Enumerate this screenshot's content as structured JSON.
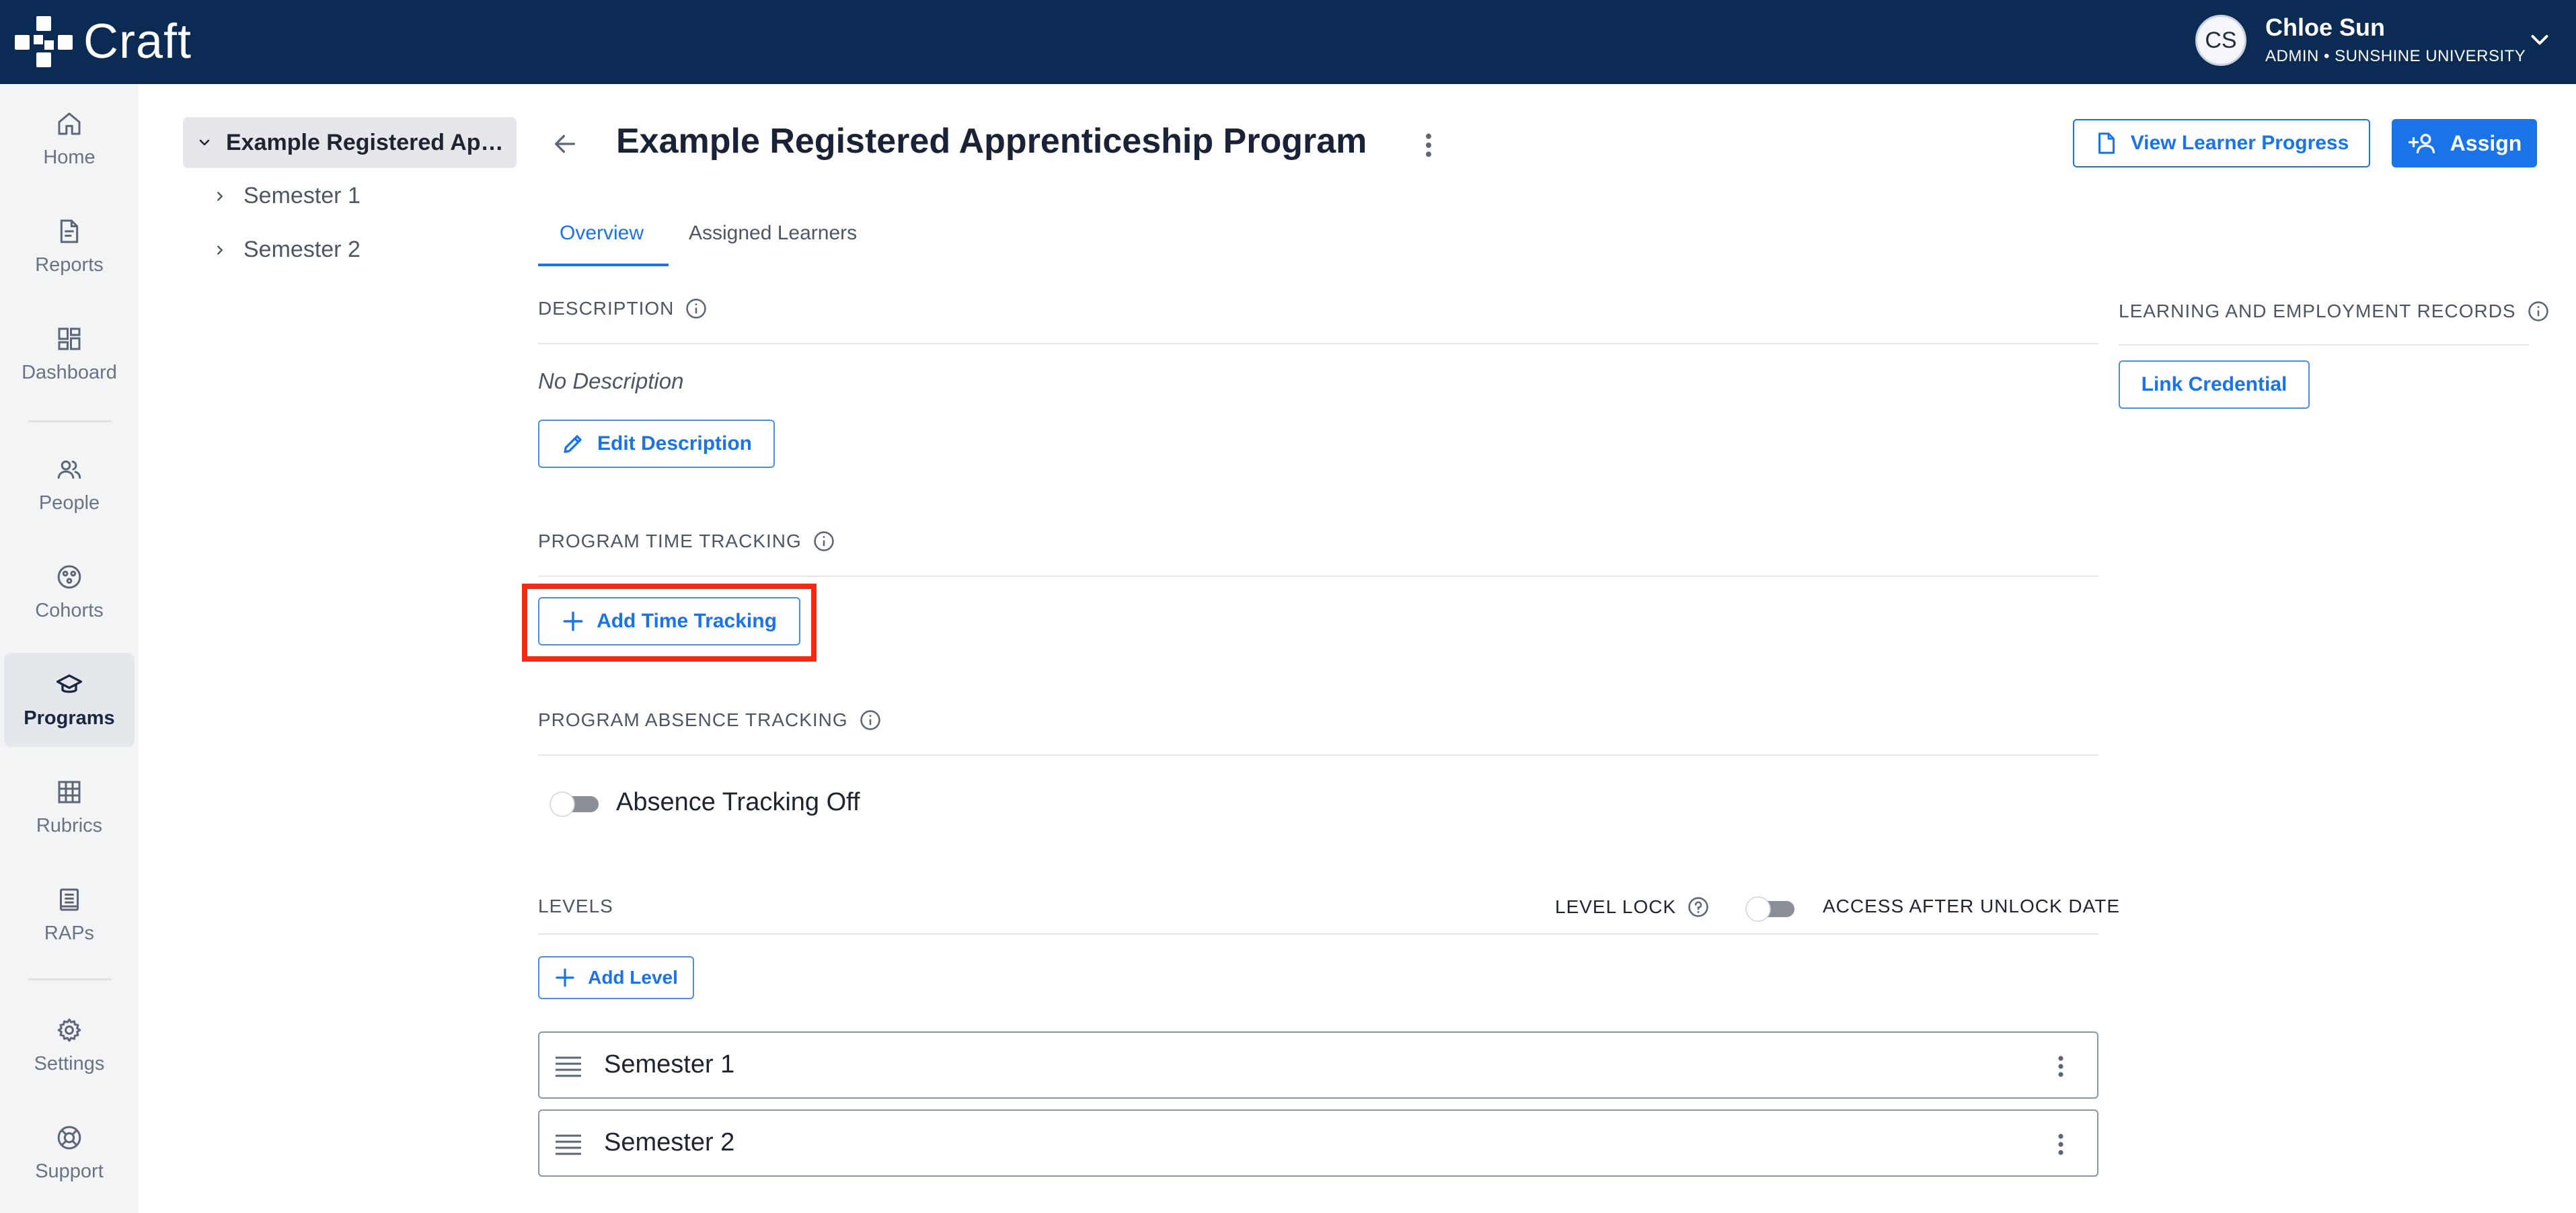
{
  "app": {
    "name": "Craft"
  },
  "user": {
    "initials": "CS",
    "name": "Chloe Sun",
    "role": "ADMIN • SUNSHINE UNIVERSITY"
  },
  "sidebar": {
    "items": [
      {
        "label": "Home",
        "icon": "home-icon"
      },
      {
        "label": "Reports",
        "icon": "document-icon"
      },
      {
        "label": "Dashboard",
        "icon": "dashboard-icon"
      },
      {
        "label": "People",
        "icon": "people-icon"
      },
      {
        "label": "Cohorts",
        "icon": "cohorts-icon"
      },
      {
        "label": "Programs",
        "icon": "graduation-cap-icon",
        "active": true
      },
      {
        "label": "Rubrics",
        "icon": "grid-icon"
      },
      {
        "label": "RAPs",
        "icon": "clipboard-icon"
      },
      {
        "label": "Settings",
        "icon": "gear-icon"
      },
      {
        "label": "Support",
        "icon": "lifebuoy-icon"
      }
    ]
  },
  "tree": {
    "root": "Example Registered Apprenticeship Program",
    "children": [
      "Semester 1",
      "Semester 2"
    ]
  },
  "header": {
    "title": "Example Registered Apprenticeship Program",
    "view_progress_label": "View Learner Progress",
    "assign_label": "Assign"
  },
  "tabs": [
    {
      "label": "Overview",
      "active": true
    },
    {
      "label": "Assigned Learners",
      "active": false
    }
  ],
  "description": {
    "heading": "DESCRIPTION",
    "value": "No Description",
    "edit_label": "Edit Description"
  },
  "time_tracking": {
    "heading": "PROGRAM TIME TRACKING",
    "add_label": "Add Time Tracking"
  },
  "absence_tracking": {
    "heading": "PROGRAM ABSENCE TRACKING",
    "toggle_label": "Absence Tracking Off",
    "enabled": false
  },
  "levels": {
    "heading": "LEVELS",
    "level_lock_label": "LEVEL LOCK",
    "access_label": "ACCESS AFTER UNLOCK DATE",
    "access_enabled": false,
    "add_label": "Add Level",
    "items": [
      "Semester 1",
      "Semester 2"
    ]
  },
  "ler": {
    "heading": "LEARNING AND EMPLOYMENT RECORDS",
    "link_label": "Link Credential"
  },
  "colors": {
    "topbar": "#0b2a54",
    "accent": "#1a73e8",
    "highlight": "#f42a12"
  }
}
